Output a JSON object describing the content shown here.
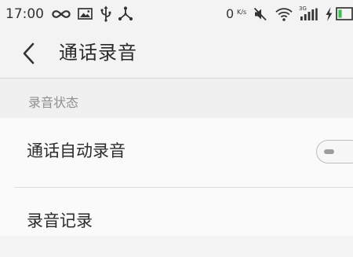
{
  "status_bar": {
    "time": "17:00",
    "network_speed": "0",
    "network_speed_unit": "K/s",
    "signal_label": "3G",
    "left_icons": [
      "infinity-icon",
      "image-icon",
      "usb-icon",
      "share-icon"
    ],
    "right_icons": [
      "mute-icon",
      "wifi-icon",
      "signal-icon",
      "charging-icon",
      "battery-icon"
    ],
    "battery_color": "#3fbf4f"
  },
  "nav": {
    "title": "通话录音",
    "back_icon": "chevron-left-icon"
  },
  "section": {
    "label": "录音状态"
  },
  "items": [
    {
      "label": "通话自动录音",
      "control": "toggle",
      "enabled": false
    },
    {
      "label": "录音记录"
    }
  ]
}
